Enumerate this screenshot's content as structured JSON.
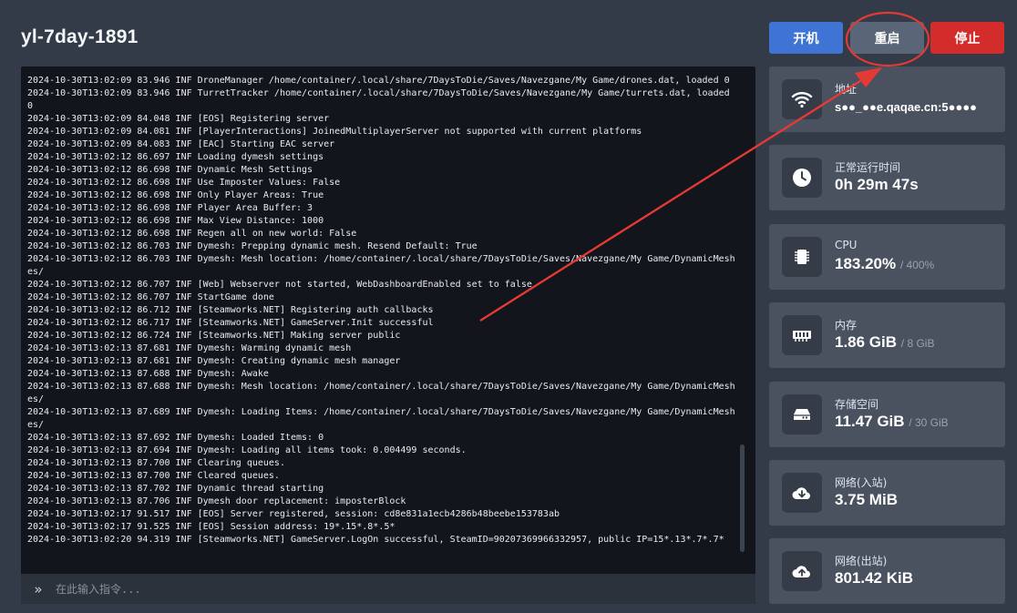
{
  "server": {
    "title": "yl-7day-1891"
  },
  "buttons": {
    "start": "开机",
    "restart": "重启",
    "stop": "停止"
  },
  "console": {
    "lines": [
      "2024-10-30T13:02:09 83.946 INF DroneManager /home/container/.local/share/7DaysToDie/Saves/Navezgane/My Game/drones.dat, loaded 0",
      "2024-10-30T13:02:09 83.946 INF TurretTracker /home/container/.local/share/7DaysToDie/Saves/Navezgane/My Game/turrets.dat, loaded 0",
      "2024-10-30T13:02:09 84.048 INF [EOS] Registering server",
      "2024-10-30T13:02:09 84.081 INF [PlayerInteractions] JoinedMultiplayerServer not supported with current platforms",
      "2024-10-30T13:02:09 84.083 INF [EAC] Starting EAC server",
      "2024-10-30T13:02:12 86.697 INF Loading dymesh settings",
      "2024-10-30T13:02:12 86.698 INF Dynamic Mesh Settings",
      "2024-10-30T13:02:12 86.698 INF Use Imposter Values: False",
      "2024-10-30T13:02:12 86.698 INF Only Player Areas: True",
      "2024-10-30T13:02:12 86.698 INF Player Area Buffer: 3",
      "2024-10-30T13:02:12 86.698 INF Max View Distance: 1000",
      "2024-10-30T13:02:12 86.698 INF Regen all on new world: False",
      "2024-10-30T13:02:12 86.703 INF Dymesh: Prepping dynamic mesh. Resend Default: True",
      "2024-10-30T13:02:12 86.703 INF Dymesh: Mesh location: /home/container/.local/share/7DaysToDie/Saves/Navezgane/My Game/DynamicMeshes/",
      "2024-10-30T13:02:12 86.707 INF [Web] Webserver not started, WebDashboardEnabled set to false",
      "2024-10-30T13:02:12 86.707 INF StartGame done",
      "2024-10-30T13:02:12 86.712 INF [Steamworks.NET] Registering auth callbacks",
      "2024-10-30T13:02:12 86.717 INF [Steamworks.NET] GameServer.Init successful",
      "2024-10-30T13:02:12 86.724 INF [Steamworks.NET] Making server public",
      "2024-10-30T13:02:13 87.681 INF Dymesh: Warming dynamic mesh",
      "2024-10-30T13:02:13 87.681 INF Dymesh: Creating dynamic mesh manager",
      "2024-10-30T13:02:13 87.688 INF Dymesh: Awake",
      "2024-10-30T13:02:13 87.688 INF Dymesh: Mesh location: /home/container/.local/share/7DaysToDie/Saves/Navezgane/My Game/DynamicMeshes/",
      "2024-10-30T13:02:13 87.689 INF Dymesh: Loading Items: /home/container/.local/share/7DaysToDie/Saves/Navezgane/My Game/DynamicMeshes/",
      "2024-10-30T13:02:13 87.692 INF Dymesh: Loaded Items: 0",
      "2024-10-30T13:02:13 87.694 INF Dymesh: Loading all items took: 0.004499 seconds.",
      "2024-10-30T13:02:13 87.700 INF Clearing queues.",
      "2024-10-30T13:02:13 87.700 INF Cleared queues.",
      "2024-10-30T13:02:13 87.702 INF Dynamic thread starting",
      "2024-10-30T13:02:13 87.706 INF Dymesh door replacement: imposterBlock",
      "2024-10-30T13:02:17 91.517 INF [EOS] Server registered, session: cd8e831a1ecb4286b48beebe153783ab",
      "2024-10-30T13:02:17 91.525 INF [EOS] Session address: 19*.15*.8*.5*",
      "2024-10-30T13:02:20 94.319 INF [Steamworks.NET] GameServer.LogOn successful, SteamID=90207369966332957, public IP=15*.13*.7*.7*"
    ],
    "prompt_icon": "»",
    "placeholder": "在此输入指令..."
  },
  "stats": {
    "address": {
      "label": "地址",
      "value": "s●●_●●e.qaqae.cn:5●●●●",
      "icon": "wifi-icon"
    },
    "uptime": {
      "label": "正常运行时间",
      "value": "0h 29m 47s",
      "icon": "clock-icon"
    },
    "cpu": {
      "label": "CPU",
      "value": "183.20%",
      "max": "/ 400%",
      "icon": "cpu-chip-icon"
    },
    "memory": {
      "label": "内存",
      "value": "1.86 GiB",
      "max": "/ 8 GiB",
      "icon": "memory-icon"
    },
    "storage": {
      "label": "存储空间",
      "value": "11.47 GiB",
      "max": "/ 30 GiB",
      "icon": "hard-drive-icon"
    },
    "net_in": {
      "label": "网络(入站)",
      "value": "3.75 MiB",
      "icon": "cloud-download-icon"
    },
    "net_out": {
      "label": "网络(出站)",
      "value": "801.42 KiB",
      "icon": "cloud-upload-icon"
    }
  },
  "colors": {
    "accent_blue": "#3f73d4",
    "stop_red": "#d42b2b",
    "annotation_red": "#e53935"
  }
}
